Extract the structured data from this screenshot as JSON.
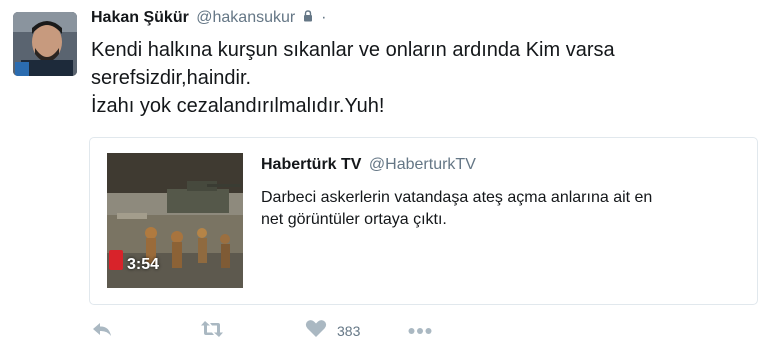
{
  "tweet": {
    "display_name": "Hakan Şükür",
    "username": "@hakansukur",
    "separator": "·",
    "text_lines": [
      "Kendi halkına kurşun sıkanlar ve onların ardında Kim varsa",
      "serefsizdir,haindir.",
      "İzahı yok cezalandırılmalıdır.Yuh!"
    ]
  },
  "card": {
    "display_name": "Habertürk TV",
    "username": "@HaberturkTV",
    "text_lines": [
      "Darbeci askerlerin vatandaşa ateş açma anlarına ait en",
      "net görüntüler ortaya çıktı."
    ],
    "video_duration": "3:54"
  },
  "actions": {
    "like_count": "383",
    "icons": [
      "reply-icon",
      "retweet-icon",
      "heart-icon",
      "more-icon"
    ]
  },
  "colors": {
    "text": "#14171a",
    "secondary": "#657786",
    "action_icon": "#aab8c2",
    "card_border": "#e1e8ed"
  }
}
